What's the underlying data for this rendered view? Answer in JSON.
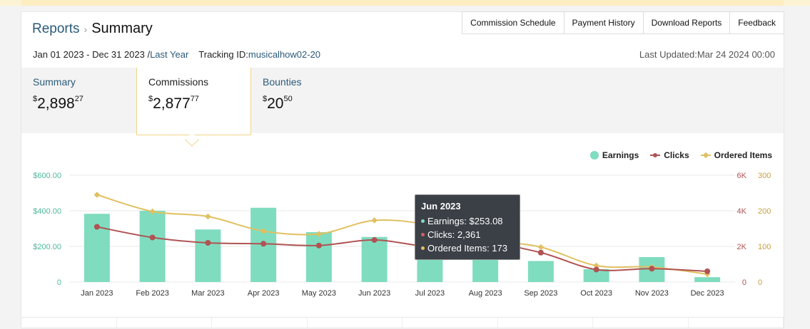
{
  "header": {
    "breadcrumb_link": "Reports",
    "breadcrumb_sep": "›",
    "breadcrumb_current": "Summary",
    "date_range": "Jan 01 2023 - Dec 31 2023 /",
    "date_preset": "Last Year",
    "tracking_label": "Tracking ID:",
    "tracking_id": "musicalhow02-20",
    "last_updated": "Last Updated:Mar 24 2024 00:00",
    "buttons": [
      "Commission Schedule",
      "Payment History",
      "Download Reports",
      "Feedback"
    ]
  },
  "tabs": [
    {
      "label": "Summary",
      "currency": "$",
      "whole": "2,898",
      "cents": "27"
    },
    {
      "label": "Commissions",
      "currency": "$",
      "whole": "2,877",
      "cents": "77"
    },
    {
      "label": "Bounties",
      "currency": "$",
      "whole": "20",
      "cents": "50"
    }
  ],
  "legend": {
    "earnings": "Earnings",
    "clicks": "Clicks",
    "orders": "Ordered Items"
  },
  "tooltip": {
    "title": "Jun 2023",
    "earnings": "Earnings: $253.08",
    "clicks": "Clicks: 2,361",
    "orders": "Ordered Items: 173"
  },
  "colors": {
    "earnings": "#7fdcbf",
    "clicks": "#b05353",
    "orders": "#e0c060",
    "left_axis": "#4fb79a",
    "right_axis_clicks": "#b05353",
    "right_axis_orders": "#c8a040"
  },
  "chart_data": {
    "type": "bar",
    "categories": [
      "Jan 2023",
      "Feb 2023",
      "Mar 2023",
      "Apr 2023",
      "May 2023",
      "Jun 2023",
      "Jul 2023",
      "Aug 2023",
      "Sep 2023",
      "Oct 2023",
      "Nov 2023",
      "Dec 2023"
    ],
    "series": [
      {
        "name": "Earnings",
        "type": "bar",
        "axis": "left",
        "values": [
          383,
          400,
          295,
          417,
          280,
          253.08,
          220,
          205,
          118,
          72,
          140,
          27
        ]
      },
      {
        "name": "Clicks",
        "type": "line",
        "axis": "right",
        "values": [
          3100,
          2500,
          2200,
          2150,
          2050,
          2361,
          2000,
          2200,
          1650,
          700,
          750,
          600
        ]
      },
      {
        "name": "Ordered Items",
        "type": "line",
        "axis": "right2",
        "values": [
          245,
          198,
          184,
          143,
          135,
          173,
          160,
          120,
          98,
          46,
          42,
          22
        ]
      }
    ],
    "left_axis": {
      "ticks": [
        "$600.00",
        "$400.00",
        "$200.00",
        "0"
      ],
      "range": [
        0,
        600
      ]
    },
    "right_axis": {
      "ticks": [
        "6K",
        "4K",
        "2K",
        "0"
      ],
      "range": [
        0,
        6000
      ]
    },
    "right_axis2": {
      "ticks": [
        "300",
        "200",
        "100",
        "0"
      ],
      "range": [
        0,
        300
      ]
    },
    "grid": true,
    "legend_position": "top-right"
  }
}
